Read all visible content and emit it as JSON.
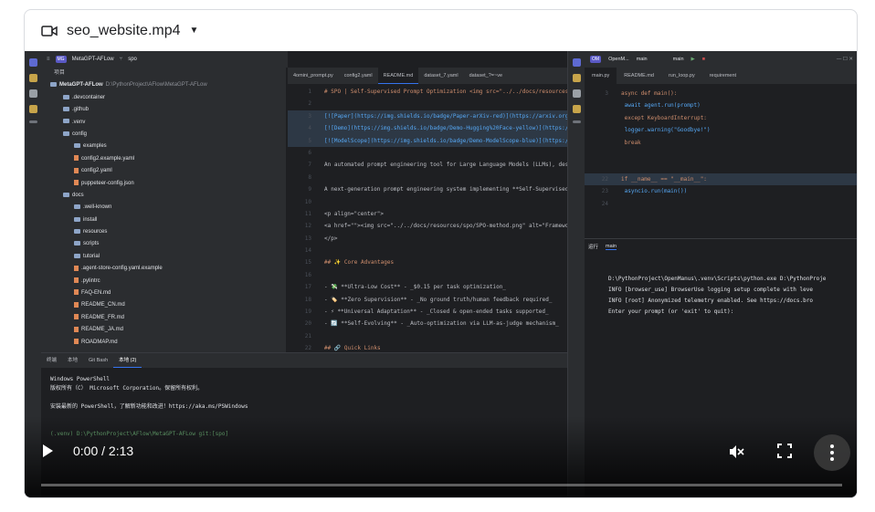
{
  "video": {
    "file_name": "seo_website.mp4",
    "time_display": "0:00 / 2:13",
    "progress_fraction": 0.0
  },
  "ide_left": {
    "project_badge": "MG",
    "project_name": "MetaGPT-AFLow",
    "branch": "spo",
    "project_header": "项目",
    "root_label": "MetaGPT-AFLow",
    "root_path": "D:\\PythonProject\\AFlow\\MetaGPT-AFLow",
    "tree": [
      {
        "label": ".devcontainer",
        "indent": 2,
        "kind": "folder"
      },
      {
        "label": ".github",
        "indent": 2,
        "kind": "folder"
      },
      {
        "label": ".venv",
        "indent": 2,
        "kind": "folder"
      },
      {
        "label": "config",
        "indent": 2,
        "kind": "folder"
      },
      {
        "label": "examples",
        "indent": 3,
        "kind": "folder"
      },
      {
        "label": "config2.example.yaml",
        "indent": 3,
        "kind": "file"
      },
      {
        "label": "config2.yaml",
        "indent": 3,
        "kind": "file"
      },
      {
        "label": "puppeteer-config.json",
        "indent": 3,
        "kind": "file"
      },
      {
        "label": "docs",
        "indent": 2,
        "kind": "folder"
      },
      {
        "label": ".well-known",
        "indent": 3,
        "kind": "folder"
      },
      {
        "label": "install",
        "indent": 3,
        "kind": "folder"
      },
      {
        "label": "resources",
        "indent": 3,
        "kind": "folder"
      },
      {
        "label": "scripts",
        "indent": 3,
        "kind": "folder"
      },
      {
        "label": "tutorial",
        "indent": 3,
        "kind": "folder"
      },
      {
        "label": ".agent-store-config.yaml.example",
        "indent": 3,
        "kind": "file"
      },
      {
        "label": ".pylintrc",
        "indent": 3,
        "kind": "file"
      },
      {
        "label": "FAQ-EN.md",
        "indent": 3,
        "kind": "file"
      },
      {
        "label": "README_CN.md",
        "indent": 3,
        "kind": "file"
      },
      {
        "label": "README_FR.md",
        "indent": 3,
        "kind": "file"
      },
      {
        "label": "README_JA.md",
        "indent": 3,
        "kind": "file"
      },
      {
        "label": "ROADMAP.md",
        "indent": 3,
        "kind": "file"
      }
    ],
    "editor_tabs": [
      "4omini_prompt.py",
      "config2.yaml",
      "README.md",
      "dataset_7.yaml",
      "dataset_?=~ve"
    ],
    "active_tab": 2,
    "code": [
      {
        "n": "1",
        "text": "# SPO | Self-Supervised Prompt Optimization <img src=\"../../docs/resources/spo/SPO-logo",
        "cls": "md"
      },
      {
        "n": "2",
        "text": "",
        "cls": ""
      },
      {
        "n": "3",
        "text": "[![Paper](https://img.shields.io/badge/Paper-arXiv-red)](https://arxiv.org/pdf/2502.06855",
        "cls": "lk"
      },
      {
        "n": "4",
        "text": "[![Demo](https://img.shields.io/badge/Demo-Hugging%20Face-yellow)](https://huggingface.c",
        "cls": "lk"
      },
      {
        "n": "5",
        "text": "[![ModelScope](https://img.shields.io/badge/Demo-ModelScope-blue)](https://modelscope.c",
        "cls": "lk"
      },
      {
        "n": "6",
        "text": "",
        "cls": ""
      },
      {
        "n": "7",
        "text": "An automated prompt engineering tool for Large Language Models (LLMs), designed for univ",
        "cls": ""
      },
      {
        "n": "8",
        "text": "",
        "cls": ""
      },
      {
        "n": "9",
        "text": "A next-generation prompt engineering system implementing **Self-Supervised Prompt Optimi",
        "cls": ""
      },
      {
        "n": "10",
        "text": "",
        "cls": ""
      },
      {
        "n": "11",
        "text": "<p align=\"center\">",
        "cls": ""
      },
      {
        "n": "12",
        "text": "<a href=\"\"><img src=\"../../docs/resources/spo/SPO-method.png\" alt=\"Framework of SPO\" tit",
        "cls": ""
      },
      {
        "n": "13",
        "text": "</p>",
        "cls": ""
      },
      {
        "n": "14",
        "text": "",
        "cls": ""
      },
      {
        "n": "15",
        "text": "## ✨ Core Advantages",
        "cls": "md"
      },
      {
        "n": "16",
        "text": "",
        "cls": ""
      },
      {
        "n": "17",
        "text": "- 💸 **Ultra-Low Cost** - _$0.15 per task optimization_",
        "cls": ""
      },
      {
        "n": "18",
        "text": "- 🏷️ **Zero Supervision** - _No ground truth/human feedback required_",
        "cls": ""
      },
      {
        "n": "19",
        "text": "- ⚡ **Universal Adaptation** - _Closed & open-ended tasks supported_",
        "cls": ""
      },
      {
        "n": "20",
        "text": "- 🔄 **Self-Evolving** - _Auto-optimization via LLM-as-judge mechanism_",
        "cls": ""
      },
      {
        "n": "21",
        "text": "",
        "cls": ""
      },
      {
        "n": "22",
        "text": "## 🔗 Quick Links",
        "cls": "md"
      },
      {
        "n": "23",
        "text": "",
        "cls": ""
      },
      {
        "n": "24",
        "text": "- [📄 Read our paper](https://arxiv.org/pdf/2502.06855)",
        "cls": "lk"
      },
      {
        "n": "25",
        "text": "- [🤗 Try our Hugging Face demo](https://huggingface.co/spaces/XiangJinYu/SPO)",
        "cls": "lk"
      }
    ],
    "terminal_tabs": [
      "终端",
      "本地",
      "Git Bash",
      "本地 (2)"
    ],
    "terminal_lines": [
      "Windows PowerShell",
      "版权所有（C） Microsoft Corporation。保留所有权利。",
      "",
      "安装最新的 PowerShell，了解新功能和改进！https://aka.ms/PSWindows",
      "",
      "",
      "(.venv) D:\\PythonProject\\AFlow\\MetaGPT-AFLow git:[spo]"
    ]
  },
  "ide_right": {
    "project_badge": "OM",
    "project_name": "OpenM...",
    "branch": "main",
    "run_config": "main",
    "tabs": [
      "main.py",
      "README.md",
      "run_loop.py",
      "requirement"
    ],
    "code": [
      {
        "n": "3",
        "text": "async def main():"
      },
      {
        "n": "",
        "text": "        await agent.run(prompt)"
      },
      {
        "n": "",
        "text": "    except KeyboardInterrupt:"
      },
      {
        "n": "",
        "text": "        logger.warning(\"Goodbye!\")"
      },
      {
        "n": "",
        "text": "        break"
      },
      {
        "n": "",
        "text": ""
      },
      {
        "n": "",
        "text": ""
      },
      {
        "n": "22",
        "text": "if __name__ == \"__main__\":"
      },
      {
        "n": "23",
        "text": "    asyncio.run(main())"
      },
      {
        "n": "24",
        "text": ""
      }
    ],
    "run_label": "运行",
    "run_tab": "main",
    "run_lines": [
      "D:\\PythonProject\\OpenManus\\.venv\\Scripts\\python.exe D:\\PythonProje",
      "INFO     [browser_use] BrowserUse logging setup complete with leve",
      "INFO     [root] Anonymized telemetry enabled. See https://docs.bro",
      "Enter your prompt (or 'exit' to quit):"
    ]
  },
  "colors": {
    "accent": "#3574f0",
    "ide_bg": "#1e1f22",
    "panel_bg": "#2b2d30"
  },
  "icons": [
    "video-camera-icon",
    "caret-down-icon",
    "play-icon",
    "mute-icon",
    "fullscreen-icon",
    "more-vert-icon"
  ]
}
